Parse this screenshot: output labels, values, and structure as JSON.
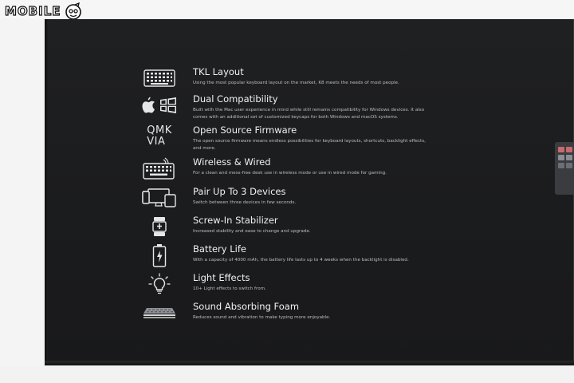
{
  "watermark": {
    "text": "MOBILE",
    "icon": "face-icon"
  },
  "features": [
    {
      "icon": "keyboard-icon",
      "title": "TKL Layout",
      "desc": "Using the most popular keyboard layout on the market, K8 meets the needs of most people."
    },
    {
      "icon": "apple-windows-icon",
      "title": "Dual Compatibility",
      "desc": "Built with the Mac user experience in mind while still remains compatibility for Windows devices. It also comes with an additional set of customized keycaps for both Windows and macOS systems."
    },
    {
      "icon": "qmk-via-icon",
      "icon_text_1": "QMK",
      "icon_text_2": "VIA",
      "title": "Open Source Firmware",
      "desc": "The open source firmware means endless possibilities for keyboard layouts, shortcuts, backlight effects, and more."
    },
    {
      "icon": "wireless-keyboard-icon",
      "title": "Wireless & Wired",
      "desc": "For a clean and mess-free desk use in wireless mode or use in wired mode for gaming."
    },
    {
      "icon": "devices-icon",
      "title": "Pair Up To 3 Devices",
      "desc": "Switch between three devices in few seconds."
    },
    {
      "icon": "stabilizer-icon",
      "title": "Screw-In Stabilizer",
      "desc": "Increased stability and ease to change and upgrade."
    },
    {
      "icon": "battery-icon",
      "title": "Battery Life",
      "desc": "With a capacity of 4000 mAh, the battery life lasts up to 4 weeks when the backlight is disabled."
    },
    {
      "icon": "bulb-icon",
      "title": "Light Effects",
      "desc": "10+ Light effects to switch from."
    },
    {
      "icon": "foam-icon",
      "title": "Sound Absorbing Foam",
      "desc": "Reduces sound and vibration to make typing more enjoyable."
    }
  ],
  "colors": {
    "box": "#1d1e20",
    "title": "#f1f1f1",
    "desc": "#bdbdbd",
    "background": "#f4f4f4"
  }
}
